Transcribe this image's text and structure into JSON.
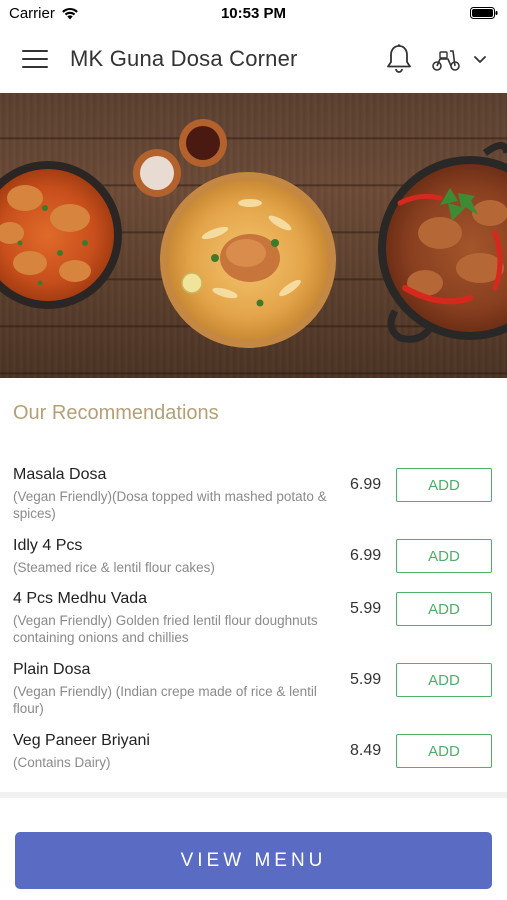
{
  "status_bar": {
    "carrier": "Carrier",
    "time": "10:53 PM",
    "wifi_icon": "wifi-icon",
    "battery_icon": "battery-icon"
  },
  "header": {
    "title": "MK Guna Dosa Corner",
    "menu_icon": "hamburger-menu-icon",
    "notification_icon": "bell-icon",
    "delivery_icon": "scooter-icon",
    "dropdown_icon": "chevron-down-icon"
  },
  "recommendations": {
    "title": "Our Recommendations",
    "items": [
      {
        "name": "Masala Dosa",
        "desc": "(Vegan Friendly)(Dosa topped with mashed potato & spices)",
        "price": "6.99",
        "add": "ADD"
      },
      {
        "name": "Idly 4 Pcs",
        "desc": "(Steamed rice & lentil flour cakes)",
        "price": "6.99",
        "add": "ADD"
      },
      {
        "name": "4 Pcs Medhu Vada",
        "desc": "(Vegan Friendly) Golden fried lentil flour doughnuts containing onions and chillies",
        "price": "5.99",
        "add": "ADD"
      },
      {
        "name": "Plain Dosa",
        "desc": "(Vegan Friendly) (Indian crepe made of rice & lentil flour)",
        "price": "5.99",
        "add": "ADD"
      },
      {
        "name": "Veg Paneer Briyani",
        "desc": "(Contains Dairy)",
        "price": "8.49",
        "add": "ADD"
      }
    ]
  },
  "footer": {
    "view_menu_label": "VIEW MENU"
  },
  "colors": {
    "accent_gold": "#b5a076",
    "add_green": "#4caf6a",
    "button_blue": "#5a6bc3"
  }
}
